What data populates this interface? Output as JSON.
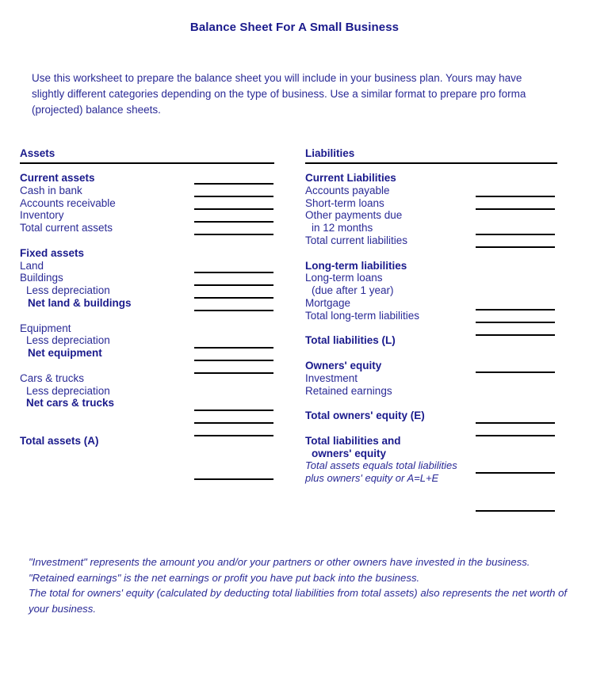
{
  "document": {
    "title": "Balance Sheet For A Small Business",
    "intro": "Use this worksheet to prepare the balance sheet you will include in your business plan.  Yours may have slightly different categories depending on the type of business.  Use a similar format to prepare pro forma (projected) balance sheets."
  },
  "colors": {
    "text": "#2a2a96",
    "heading": "#1a1a8c",
    "rule": "#000000",
    "background": "#ffffff"
  },
  "assets": {
    "heading": "Assets",
    "groups": [
      {
        "name": "current-assets",
        "title": "Current assets",
        "items": [
          {
            "label": "Cash in bank",
            "bold": false,
            "indent": 0,
            "line": true
          },
          {
            "label": "Accounts receivable",
            "bold": false,
            "indent": 0,
            "line": true
          },
          {
            "label": "Inventory",
            "bold": false,
            "indent": 0,
            "line": true
          },
          {
            "label": "Total current assets",
            "bold": false,
            "indent": 0,
            "line": true
          }
        ]
      },
      {
        "name": "fixed-assets",
        "title": "Fixed assets",
        "items": [
          {
            "label": "Land",
            "bold": false,
            "indent": 0,
            "line": false
          },
          {
            "label": "Buildings",
            "bold": false,
            "indent": 0,
            "line": true
          },
          {
            "label": "Less depreciation",
            "bold": false,
            "indent": 1,
            "line": true
          },
          {
            "label": "Net land & buildings",
            "bold": true,
            "indent": 2,
            "line": true
          }
        ]
      },
      {
        "name": "equipment",
        "title": "",
        "items": [
          {
            "label": "Equipment",
            "bold": false,
            "indent": 0,
            "line": false
          },
          {
            "label": "Less depreciation",
            "bold": false,
            "indent": 1,
            "line": true
          },
          {
            "label": "Net equipment",
            "bold": true,
            "indent": 2,
            "line": true
          }
        ]
      },
      {
        "name": "cars-trucks",
        "title": "",
        "items": [
          {
            "label": "Cars & trucks",
            "bold": false,
            "indent": 0,
            "line": false
          },
          {
            "label": "Less depreciation",
            "bold": false,
            "indent": 1,
            "line": true
          },
          {
            "label": "Net cars & trucks",
            "bold": true,
            "indent": 1,
            "line": true
          }
        ]
      }
    ],
    "total": {
      "label": "Total assets (A)",
      "line": true
    }
  },
  "liabilities": {
    "heading": "Liabilities",
    "groups": [
      {
        "name": "current-liabilities",
        "title": "Current Liabilities",
        "items": [
          {
            "label": "Accounts payable",
            "bold": false,
            "indent": 0,
            "line": true
          },
          {
            "label": "Short-term loans",
            "bold": false,
            "indent": 0,
            "line": true
          },
          {
            "label": "Other payments due",
            "bold": false,
            "indent": 0,
            "line": false
          },
          {
            "label": "in 12 months",
            "bold": false,
            "indent": 1,
            "line": true
          },
          {
            "label": "Total current liabilities",
            "bold": false,
            "indent": 0,
            "line": true
          }
        ]
      },
      {
        "name": "long-term-liabilities",
        "title": "Long-term liabilities",
        "items": [
          {
            "label": "Long-term loans",
            "bold": false,
            "indent": 0,
            "line": false
          },
          {
            "label": "(due after 1 year)",
            "bold": false,
            "indent": 1,
            "line": true
          },
          {
            "label": "Mortgage",
            "bold": false,
            "indent": 0,
            "line": true
          },
          {
            "label": "Total long-term liabilities",
            "bold": false,
            "indent": 0,
            "line": true
          }
        ]
      }
    ],
    "total_liabilities": {
      "label": "Total liabilities (L)",
      "line": true
    },
    "owners_equity": {
      "title": "Owners' equity",
      "items": [
        {
          "label": "Investment",
          "bold": false,
          "indent": 0,
          "line": true
        },
        {
          "label": "Retained earnings",
          "bold": false,
          "indent": 0,
          "line": true
        }
      ],
      "total": {
        "label": "Total owners' equity (E)",
        "line": true
      }
    },
    "grand_total": {
      "line1": "Total liabilities and",
      "line2": "owners' equity",
      "note_line1": "Total assets equals total liabilities",
      "note_line2": "plus owners' equity or A=L+E"
    }
  },
  "footnotes": [
    "\"Investment\" represents the amount you and/or your partners or other owners have invested in the business.",
    "\"Retained earnings\" is the net earnings or profit you have put back into the business.",
    "The total for owners' equity (calculated by deducting total liabilities from total assets) also represents the net worth of your business."
  ]
}
